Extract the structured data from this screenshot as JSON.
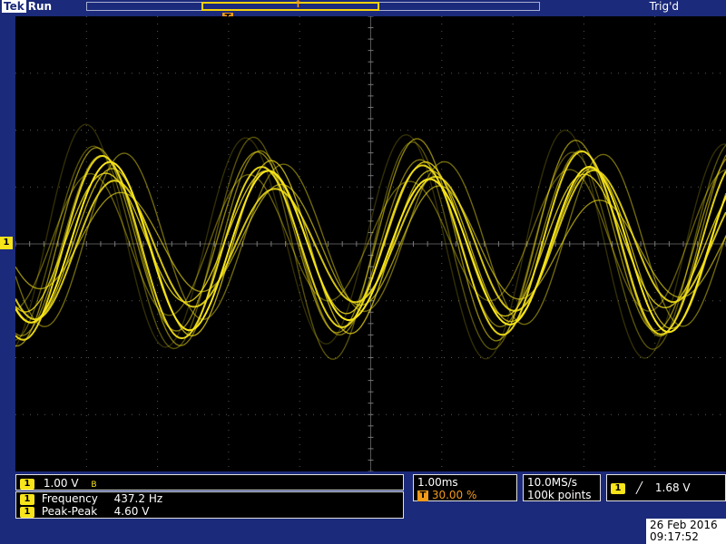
{
  "header": {
    "brand": "Tek",
    "run_state": "Run",
    "trigger_status": "Trig'd",
    "trigger_marker_label": "T",
    "trigger_pos_marker": "†"
  },
  "channel1": {
    "marker_label": "1",
    "scale": "1.00 V",
    "bandwidth_icon": "bw-limit-icon",
    "color": "#f7e41a"
  },
  "measurements": [
    {
      "label": "Frequency",
      "value": "437.2 Hz"
    },
    {
      "label": "Peak-Peak",
      "value": "4.60 V"
    }
  ],
  "timebase": {
    "scale": "1.00ms",
    "trigger_position": "30.00 %"
  },
  "acquisition": {
    "sample_rate": "10.0MS/s",
    "record_length": "100k points"
  },
  "trigger": {
    "source": "1",
    "slope_icon": "rising-edge-icon",
    "level": "1.68 V"
  },
  "datetime": {
    "date": "26 Feb  2016",
    "time": "09:17:52"
  },
  "colors": {
    "background": "#1b2a7a",
    "screen": "#000000",
    "trace": "#f7e41a",
    "trigger": "#f29a1a"
  }
}
